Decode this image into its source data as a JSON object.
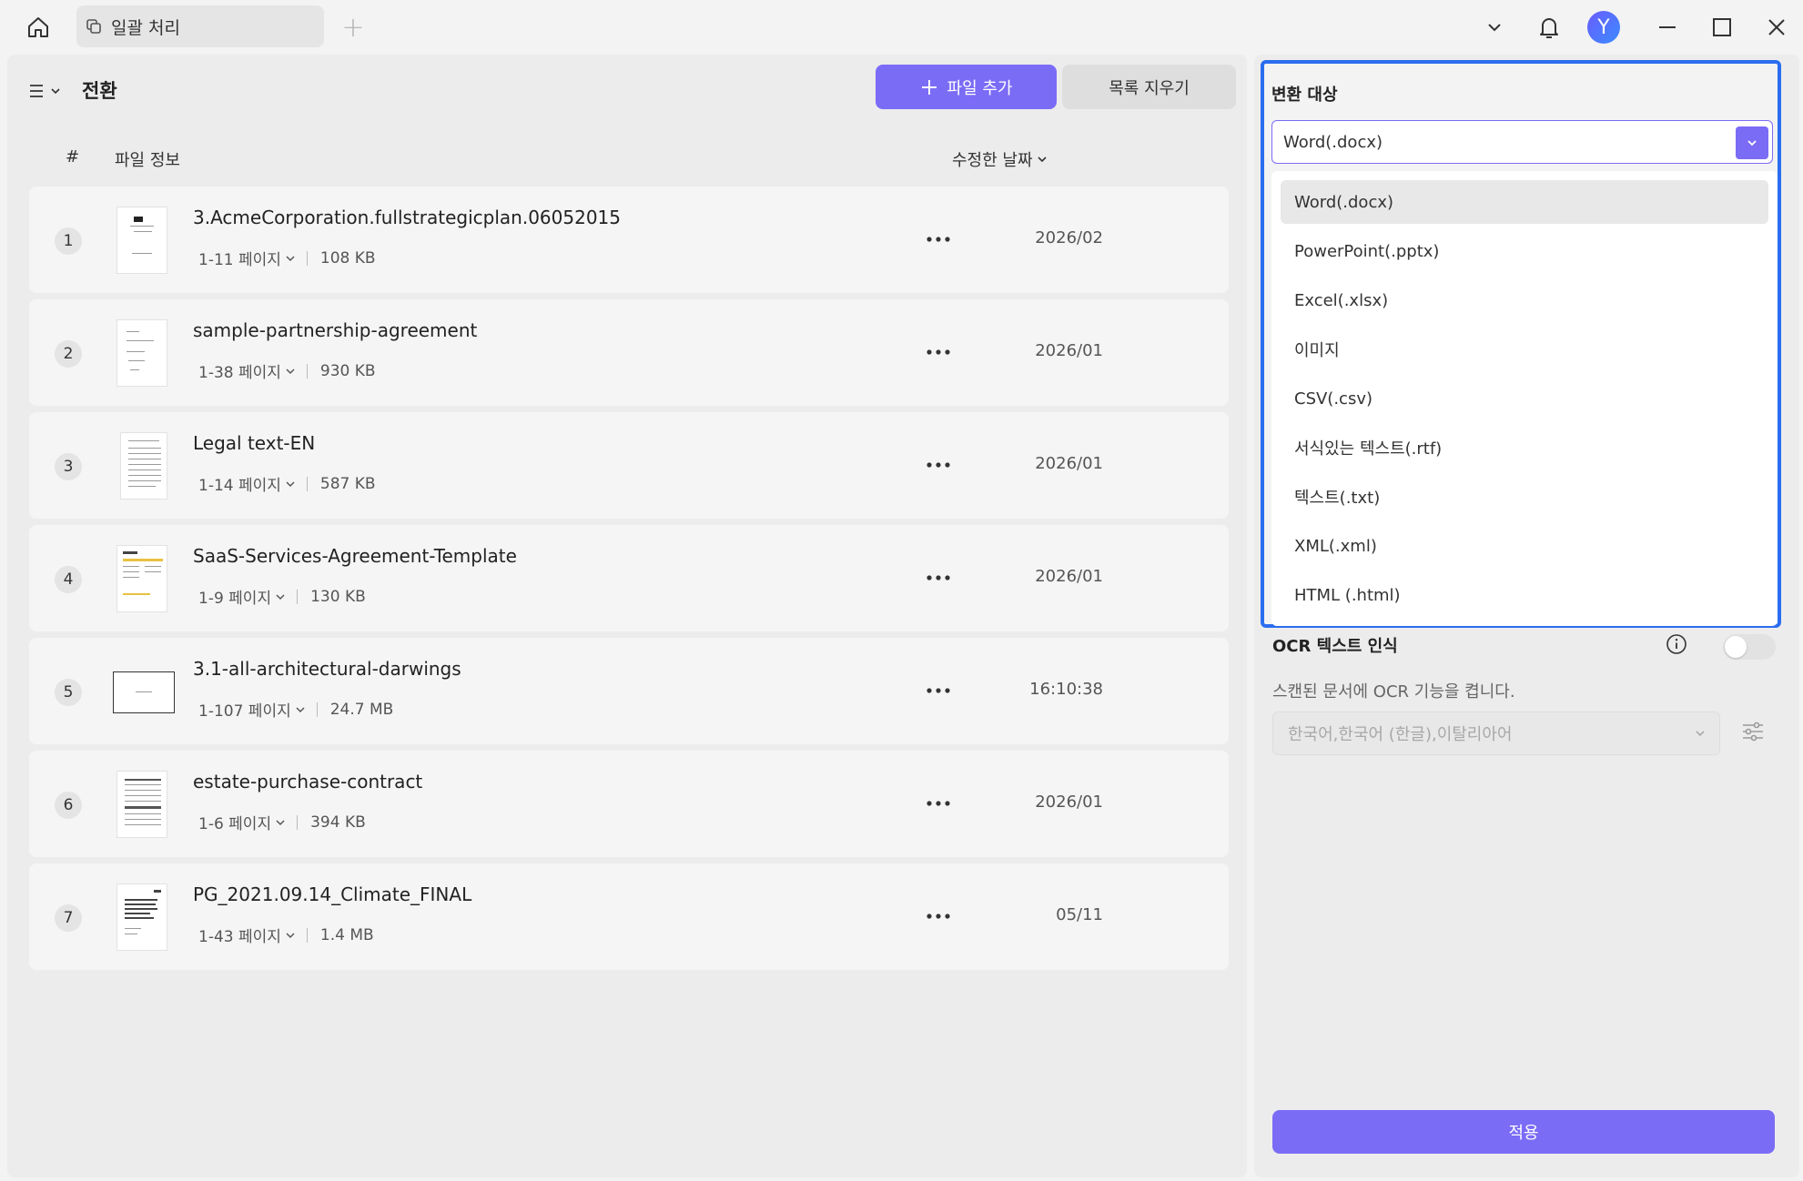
{
  "titlebar": {
    "tab_label": "일괄 처리",
    "avatar_letter": "Y"
  },
  "toolbar": {
    "title": "전환",
    "add_file_label": "파일 추가",
    "clear_list_label": "목록 지우기"
  },
  "columns": {
    "index": "#",
    "file_info": "파일 정보",
    "modified": "수정한 날짜"
  },
  "files": [
    {
      "num": "1",
      "name": "3.AcmeCorporation.fullstrategicplan.06052015",
      "pages": "1-11 페이지",
      "size": "108 KB",
      "date": "2026/02"
    },
    {
      "num": "2",
      "name": "sample-partnership-agreement",
      "pages": "1-38 페이지",
      "size": "930 KB",
      "date": "2026/01"
    },
    {
      "num": "3",
      "name": "Legal text-EN",
      "pages": "1-14 페이지",
      "size": "587 KB",
      "date": "2026/01"
    },
    {
      "num": "4",
      "name": "SaaS-Services-Agreement-Template",
      "pages": "1-9 페이지",
      "size": "130 KB",
      "date": "2026/01"
    },
    {
      "num": "5",
      "name": "3.1-all-architectural-darwings",
      "pages": "1-107 페이지",
      "size": "24.7 MB",
      "date": "16:10:38"
    },
    {
      "num": "6",
      "name": "estate-purchase-contract",
      "pages": "1-6 페이지",
      "size": "394 KB",
      "date": "2026/01"
    },
    {
      "num": "7",
      "name": "PG_2021.09.14_Climate_FINAL",
      "pages": "1-43 페이지",
      "size": "1.4 MB",
      "date": "05/11"
    }
  ],
  "convert": {
    "label": "변환 대상",
    "selected": "Word(.docx)",
    "options": [
      "Word(.docx)",
      "PowerPoint(.pptx)",
      "Excel(.xlsx)",
      "이미지",
      "CSV(.csv)",
      "서식있는 텍스트(.rtf)",
      "텍스트(.txt)",
      "XML(.xml)",
      "HTML (.html)"
    ]
  },
  "ocr": {
    "title": "OCR 텍스트 인식",
    "enabled": false,
    "description": "스캔된 문서에 OCR 기능을 켭니다.",
    "languages": "한국어,한국어 (한글),이탈리아어"
  },
  "apply_label": "적용",
  "colors": {
    "accent": "#7b6cf6",
    "focus_border": "#2b6df0"
  }
}
